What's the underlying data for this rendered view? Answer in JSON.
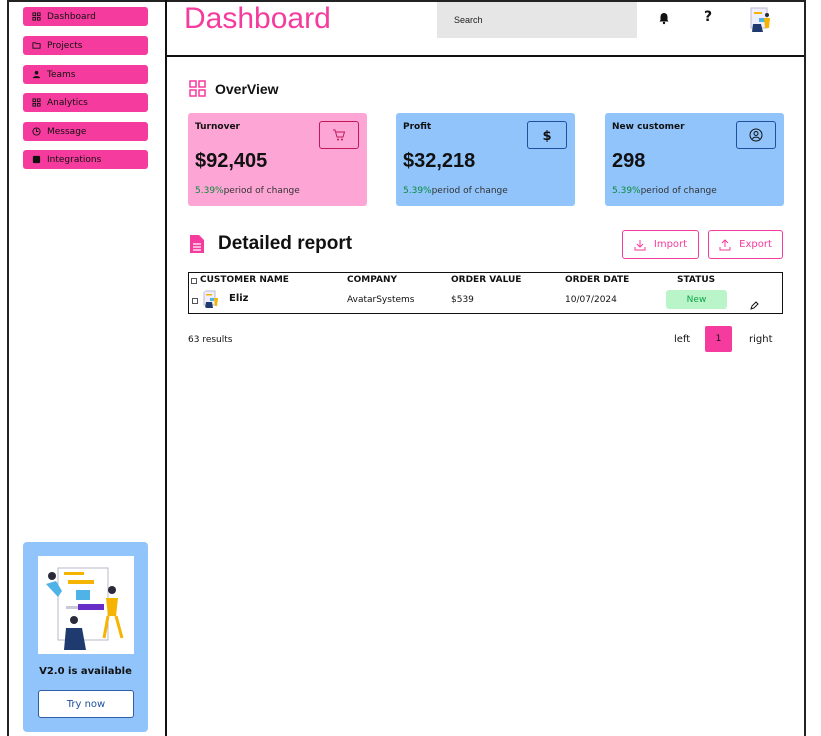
{
  "app": {
    "title": "Dashboard"
  },
  "colors": {
    "accent": "#f53b9d",
    "card_pink": "#fda5d5",
    "card_blue": "#90c4fb",
    "positive": "#0a8a3a",
    "badge_bg": "#b9f5c8"
  },
  "sidebar": {
    "items": [
      {
        "label": "Dashboard",
        "icon": "grid-icon"
      },
      {
        "label": "Projects",
        "icon": "folder-icon"
      },
      {
        "label": "Teams",
        "icon": "team-icon"
      },
      {
        "label": "Analytics",
        "icon": "analytics-icon"
      },
      {
        "label": "Message",
        "icon": "clock-icon"
      },
      {
        "label": "Integrations",
        "icon": "puzzle-icon"
      }
    ],
    "promo": {
      "title": "V2.0 is available",
      "button": "Try now"
    }
  },
  "header": {
    "search_placeholder": "Search",
    "bell_icon": "bell-icon",
    "help_label": "?"
  },
  "overview": {
    "title": "OverView",
    "cards": [
      {
        "label": "Turnover",
        "value": "$92,405",
        "change_pct": "5.39%",
        "change_text": "period of change",
        "icon": "cart-icon"
      },
      {
        "label": "Profit",
        "value": "$32,218",
        "change_pct": "5.39%",
        "change_text": "period of change",
        "icon": "dollar-icon"
      },
      {
        "label": "New customer",
        "value": "298",
        "change_pct": "5.39%",
        "change_text": "period of change",
        "icon": "user-icon"
      }
    ]
  },
  "report": {
    "title": "Detailed report",
    "import_label": "Import",
    "export_label": "Export",
    "columns": [
      "CUSTOMER NAME",
      "COMPANY",
      "ORDER VALUE",
      "ORDER DATE",
      "STATUS"
    ],
    "rows": [
      {
        "name": "Eliz",
        "company": "AvatarSystems",
        "value": "$539",
        "date": "10/07/2024",
        "status": "New"
      }
    ],
    "results": "63 results",
    "pager": {
      "left": "left",
      "current": "1",
      "right": "right"
    }
  }
}
